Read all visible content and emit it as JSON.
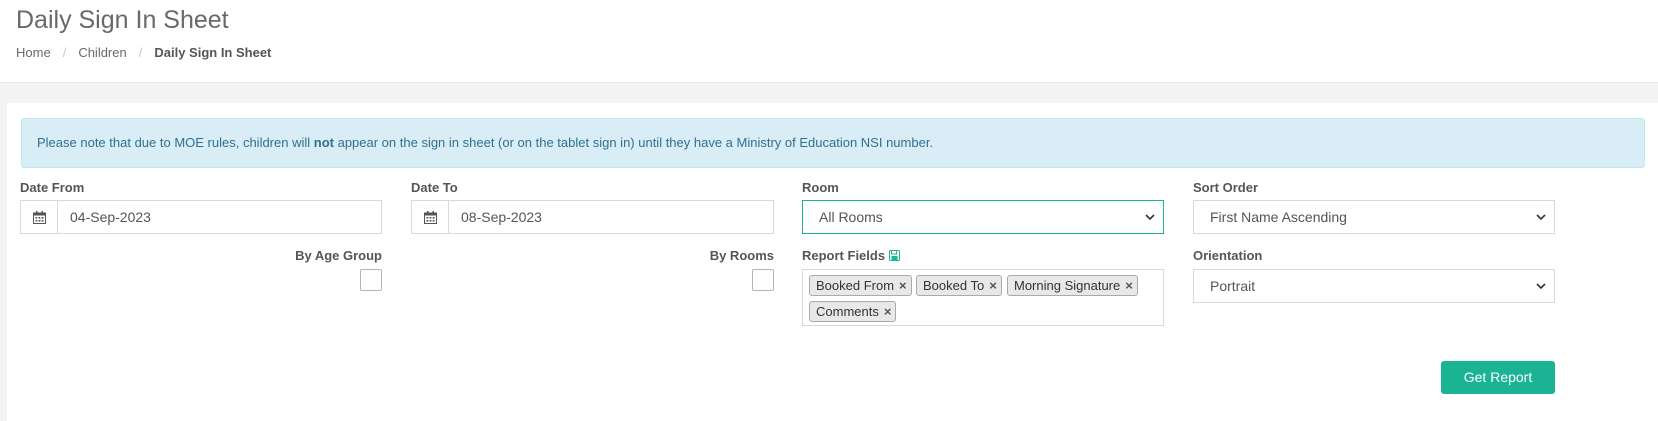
{
  "header": {
    "title": "Daily Sign In Sheet",
    "breadcrumb": {
      "home": "Home",
      "children": "Children",
      "current": "Daily Sign In Sheet",
      "separator": "/"
    }
  },
  "alert": {
    "before": "Please note that due to MOE rules, children will ",
    "emphasis": "not",
    "after": " appear on the sign in sheet (or on the tablet sign in) until they have a Ministry of Education NSI number."
  },
  "form": {
    "date_from": {
      "label": "Date From",
      "value": "04-Sep-2023",
      "icon": "calendar-icon"
    },
    "date_to": {
      "label": "Date To",
      "value": "08-Sep-2023",
      "icon": "calendar-icon"
    },
    "room": {
      "label": "Room",
      "value": "All Rooms"
    },
    "sort_order": {
      "label": "Sort Order",
      "value": "First Name Ascending"
    },
    "by_age_group": {
      "label": "By Age Group",
      "checked": false
    },
    "by_rooms": {
      "label": "By Rooms",
      "checked": false
    },
    "report_fields": {
      "label": "Report Fields",
      "icon": "save-icon",
      "tags": [
        "Booked From",
        "Booked To",
        "Morning Signature",
        "Comments"
      ],
      "remove_glyph": "×"
    },
    "orientation": {
      "label": "Orientation",
      "value": "Portrait"
    }
  },
  "actions": {
    "get_report": "Get Report"
  },
  "colors": {
    "accent": "#1ab394",
    "alert_bg": "#d9edf7",
    "alert_text": "#31708f"
  }
}
